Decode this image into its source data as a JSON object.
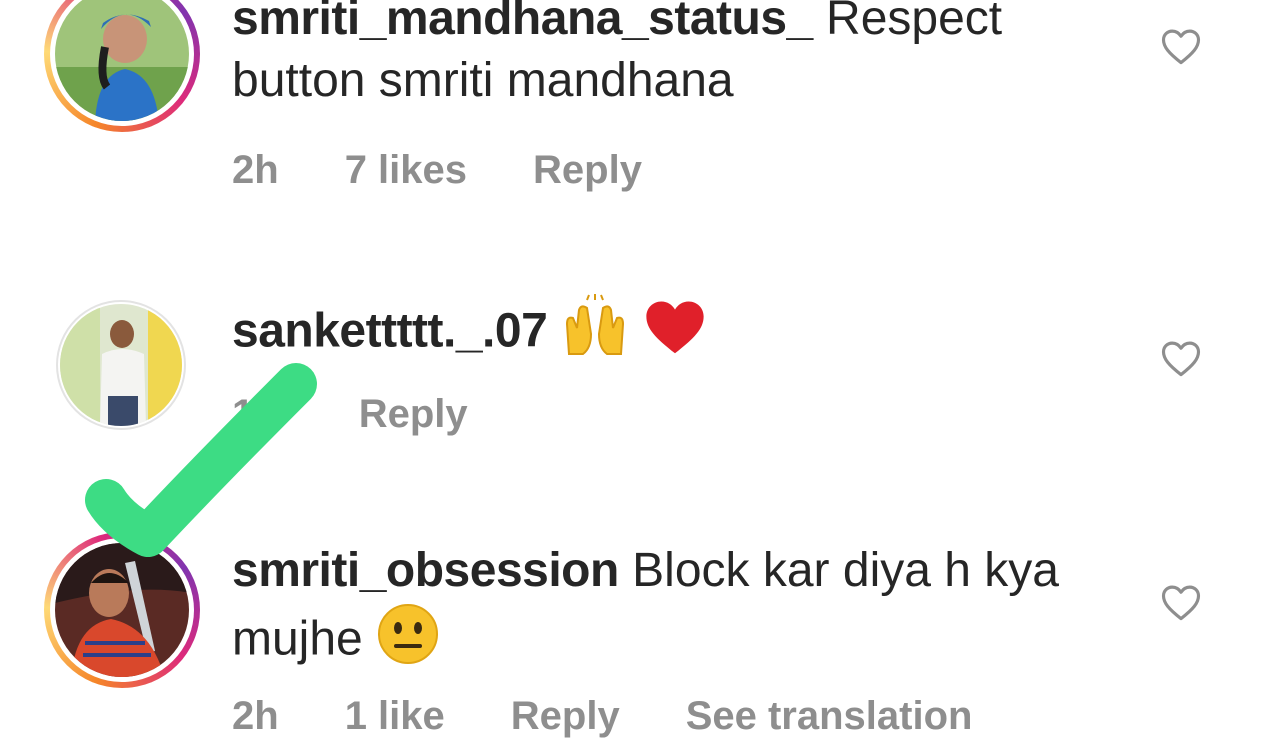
{
  "comments": [
    {
      "username": "smriti_mandhana_status_",
      "text": " Respect button smriti mandhana",
      "time": "2h",
      "likes": "7 likes",
      "reply": "Reply"
    },
    {
      "username": "sankettttt._.07",
      "text": "",
      "emojis": [
        "raising-hands",
        "red-heart"
      ],
      "time": "1h",
      "reply": "Reply"
    },
    {
      "username": "smriti_obsession",
      "text": " Block kar diya h kya mujhe",
      "emojis": [
        "neutral-face"
      ],
      "time": "2h",
      "likes": "1 like",
      "reply": "Reply",
      "see_translation": "See translation"
    }
  ],
  "colors": {
    "text": "#262626",
    "meta": "#8e8e8e",
    "checkmark": "#3ddc84",
    "heart_emoji": "#e0202a",
    "emoji_yellow": "#f7c22b"
  },
  "overlay": {
    "icon": "green-checkmark"
  }
}
